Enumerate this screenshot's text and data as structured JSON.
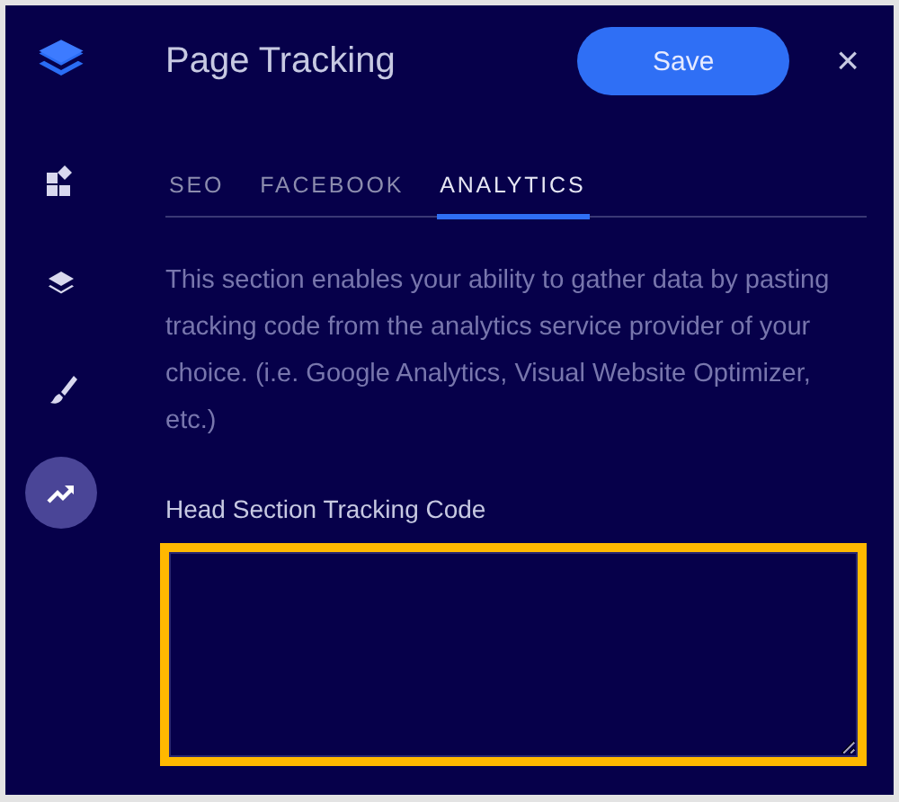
{
  "sidebar": {
    "items": [
      {
        "kind": "grid",
        "selected": false
      },
      {
        "kind": "layers",
        "selected": false
      },
      {
        "kind": "brush",
        "selected": false
      },
      {
        "kind": "trend",
        "selected": true
      }
    ]
  },
  "panel": {
    "title": "Page Tracking",
    "save_button": "Save",
    "close": "×"
  },
  "tabs": [
    {
      "label": "SEO",
      "selected": false
    },
    {
      "label": "FACEBOOK",
      "selected": false
    },
    {
      "label": "ANALYTICS",
      "selected": true
    }
  ],
  "description": "This section enables your ability to gather data by pasting tracking code from the analytics service provider of your choice. (i.e. Google Analytics, Visual Website Optimizer, etc.)",
  "field": {
    "label": "Head Section Tracking Code",
    "highlighted": true
  }
}
